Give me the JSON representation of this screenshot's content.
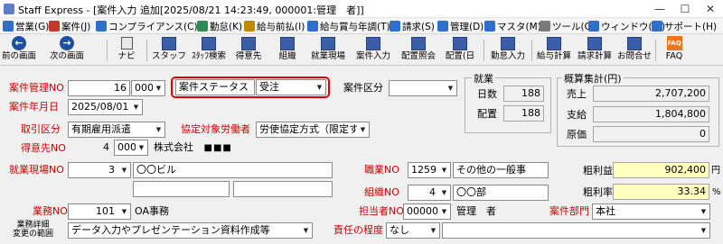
{
  "window": {
    "title": "Staff Express - [案件入力 追加[2025/08/21 14:23:49, 000001:管理　者]]",
    "minimize": "—",
    "maximize": "☐",
    "close": "✕"
  },
  "menu": [
    {
      "label": "営業(G)",
      "icon": "sales-icon",
      "color": "#2f6fcc"
    },
    {
      "label": "案件(J)",
      "icon": "case-icon",
      "color": "#c0392b"
    },
    {
      "label": "コンプライアンス(C)",
      "icon": "compliance-icon",
      "color": "#2f6fcc"
    },
    {
      "label": "勤怠(K)",
      "icon": "attendance-icon",
      "color": "#2e8b57"
    },
    {
      "label": "給与前払(I)",
      "icon": "advance-pay-icon",
      "color": "#c08a00"
    },
    {
      "label": "給与賞与年調(T)",
      "icon": "payroll-icon",
      "color": "#2f6fcc"
    },
    {
      "label": "請求(S)",
      "icon": "billing-icon",
      "color": "#2f6fcc"
    },
    {
      "label": "管理(D)",
      "icon": "admin-icon",
      "color": "#2f6fcc"
    },
    {
      "label": "マスタ(M)",
      "icon": "master-icon",
      "color": "#2f6fcc"
    },
    {
      "label": "ツール(O)",
      "icon": "tool-icon",
      "color": "#7a7a7a"
    },
    {
      "label": "ウィンドウ(W)",
      "icon": "window-icon",
      "color": "#2f6fcc"
    },
    {
      "label": "サポート(H)",
      "icon": "support-icon",
      "color": "#2f6fcc"
    }
  ],
  "toolbar": {
    "prev": "前の画面",
    "next": "次の画面",
    "navi": "ナビ",
    "staff": "スタッフ",
    "staff_search": "ｽﾀｯﾌ検索",
    "customer": "得意先",
    "org": "組織",
    "site": "就業現場",
    "case_input": "案件入力",
    "dispatch_inquiry": "配置照会",
    "dispatch_day": "配置(日",
    "attendance_input": "勤怠入力",
    "payroll_calc": "給与計算",
    "billing_calc": "請求計算",
    "contact": "お問合せ",
    "faq": "FAQ",
    "faq_icon_text": "FAQ"
  },
  "form": {
    "case_no_label": "案件管理NO",
    "case_no_value": "16",
    "case_no_sub": "000",
    "case_status_label": "案件ステータス",
    "case_status_value": "受注",
    "case_category_label": "案件区分",
    "case_category_value": "",
    "case_date_label": "案件年月日",
    "case_date_value": "2025/08/01",
    "deal_type_label": "取引区分",
    "deal_type_value": "有期雇用派遣",
    "agreement_label": "協定対象労働者",
    "agreement_value": "労使協定方式（限定す",
    "customer_label": "得意先NO",
    "customer_no": "4",
    "customer_sub": "000",
    "customer_name": "株式会社",
    "customer_name_mask": "■■■",
    "site_label": "就業現場NO",
    "site_no": "3",
    "site_name": "〇〇ビル",
    "occupation_label": "職業NO",
    "occupation_no": "1259",
    "occupation_name": "その他の一般事",
    "org_label": "組織NO",
    "org_no": "4",
    "org_name": "〇〇部",
    "duty_label": "業務NO",
    "duty_no": "101",
    "duty_name": "OA事務",
    "person_label": "担当者NO",
    "person_no": "000001",
    "person_name": "管理　者",
    "dept_label": "案件部門",
    "dept_value": "本社",
    "scope_label_1": "業務詳細",
    "scope_label_2": "変更の範囲",
    "scope_value": "データ入力やプレゼンテーション資料作成等",
    "resp_label": "責任の程度",
    "resp_value": "なし"
  },
  "work": {
    "title": "就業",
    "days_label": "日数",
    "days_value": "188",
    "placement_label": "配置",
    "placement_value": "188"
  },
  "summary": {
    "title": "概算集計(円)",
    "sales_label": "売上",
    "sales_value": "2,707,200",
    "payment_label": "支給",
    "payment_value": "1,804,800",
    "cost_label": "原価",
    "cost_value": "0",
    "gross_label": "粗利益",
    "gross_value": "902,400",
    "gross_unit": "円",
    "rate_label": "粗利率",
    "rate_value": "33.34",
    "rate_unit": "%"
  },
  "colors": {
    "required_label": "#d00000",
    "highlight_border": "#e00000",
    "yellow_field": "#ffffc0"
  }
}
